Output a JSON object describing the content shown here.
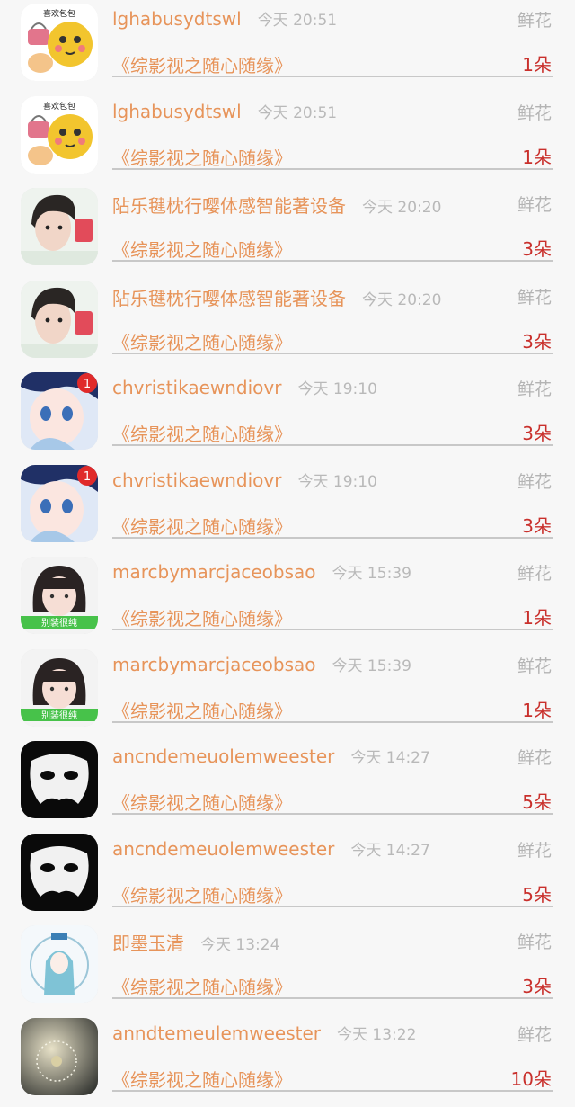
{
  "gift_label": "鲜花",
  "items": [
    {
      "name": "lghabusydtswl",
      "time": "今天 20:51",
      "book": "《综影视之随心随缘》",
      "count": "1朵",
      "avatar": "emoji-bag-avatar",
      "avatar_text": "喜欢包包"
    },
    {
      "name": "lghabusydtswl",
      "time": "今天 20:51",
      "book": "《综影视之随心随缘》",
      "count": "1朵",
      "avatar": "emoji-bag-avatar",
      "avatar_text": "喜欢包包"
    },
    {
      "name": "阽乐毽枕行嘤体感智能著设备",
      "time": "今天 20:20",
      "book": "《综影视之随心随缘》",
      "count": "3朵",
      "avatar": "young-man-avatar"
    },
    {
      "name": "阽乐毽枕行嘤体感智能著设备",
      "time": "今天 20:20",
      "book": "《综影视之随心随缘》",
      "count": "3朵",
      "avatar": "young-man-avatar"
    },
    {
      "name": "chvristikaewndiovr",
      "time": "今天 19:10",
      "book": "《综影视之随心随缘》",
      "count": "3朵",
      "avatar": "anime-girl-avatar",
      "badge": "1"
    },
    {
      "name": "chvristikaewndiovr",
      "time": "今天 19:10",
      "book": "《综影视之随心随缘》",
      "count": "3朵",
      "avatar": "anime-girl-avatar",
      "badge": "1"
    },
    {
      "name": "marcbymarcjaceobsao",
      "time": "今天 15:39",
      "book": "《综影视之随心随缘》",
      "count": "1朵",
      "avatar": "bob-hair-girl-avatar",
      "avatar_text": "别装很纯"
    },
    {
      "name": "marcbymarcjaceobsao",
      "time": "今天 15:39",
      "book": "《综影视之随心随缘》",
      "count": "1朵",
      "avatar": "bob-hair-girl-avatar",
      "avatar_text": "别装很纯"
    },
    {
      "name": "ancndemeuolemweester",
      "time": "今天 14:27",
      "book": "《综影视之随心随缘》",
      "count": "5朵",
      "avatar": "white-mask-avatar"
    },
    {
      "name": "ancndemeuolemweester",
      "time": "今天 14:27",
      "book": "《综影视之随心随缘》",
      "count": "5朵",
      "avatar": "white-mask-avatar"
    },
    {
      "name": "即墨玉清",
      "time": "今天 13:24",
      "book": "《综影视之随心随缘》",
      "count": "3朵",
      "avatar": "anime-character-avatar"
    },
    {
      "name": "anndtemeulemweester",
      "time": "今天 13:22",
      "book": "《综影视之随心随缘》",
      "count": "10朵",
      "avatar": "dandelion-avatar"
    }
  ]
}
